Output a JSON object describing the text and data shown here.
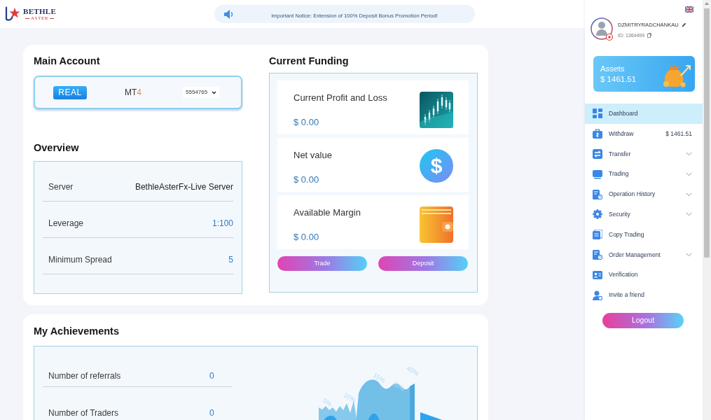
{
  "header": {
    "logo": {
      "name": "BETHLE",
      "tagline": "ASTER"
    },
    "notice": "Important Notice: Extension of 100% Deposit Bonus Promotion Period!"
  },
  "main_account": {
    "title": "Main Account",
    "account_type": "REAL",
    "platform": {
      "name": "MT",
      "version": "4"
    },
    "account_number": "5554765"
  },
  "overview": {
    "title": "Overview",
    "rows": [
      {
        "label": "Server",
        "value": "BethleAsterFx-Live Server",
        "kind": "plain"
      },
      {
        "label": "Leverage",
        "value": "1:100",
        "kind": "accent"
      },
      {
        "label": "Minimum Spread",
        "value": "5",
        "kind": "accent"
      }
    ]
  },
  "current_funding": {
    "title": "Current Funding",
    "items": [
      {
        "label": "Current Profit and Loss",
        "value": "$ 0.00",
        "kind": "chart"
      },
      {
        "label": "Net value",
        "value": "$ 0.00",
        "kind": "coin",
        "symbol": "$"
      },
      {
        "label": "Available Margin",
        "value": "$ 0.00",
        "kind": "wallet"
      }
    ],
    "buttons": [
      "Trade",
      "Deposit"
    ]
  },
  "achievements": {
    "title": "My Achievements",
    "rows": [
      {
        "label": "Number of referrals",
        "value": "0"
      },
      {
        "label": "Number of Traders",
        "value": "0"
      }
    ],
    "illustration_labels": [
      "5%",
      "10%",
      "15%",
      "30%",
      "40%"
    ]
  },
  "sidebar": {
    "user": {
      "name": "DZMITRYRADCHANKAU",
      "id": "ID: 1364499"
    },
    "assets": {
      "label": "Assets",
      "amount": "$ 1461.51"
    },
    "menu": [
      {
        "label": "Dashboard",
        "selected": true,
        "expandable": false
      },
      {
        "label": "Withdraw",
        "selected": false,
        "expandable": false,
        "amount": "$ 1461.51"
      },
      {
        "label": "Transfer",
        "selected": false,
        "expandable": true
      },
      {
        "label": "Trading",
        "selected": false,
        "expandable": true
      },
      {
        "label": "Operation History",
        "selected": false,
        "expandable": true
      },
      {
        "label": "Security",
        "selected": false,
        "expandable": true
      },
      {
        "label": "Copy Trading",
        "selected": false,
        "expandable": false
      },
      {
        "label": "Order Management",
        "selected": false,
        "expandable": true
      },
      {
        "label": "Verification",
        "selected": false,
        "expandable": false
      },
      {
        "label": "Invite a friend",
        "selected": false,
        "expandable": false
      }
    ],
    "logout": "Logout"
  }
}
